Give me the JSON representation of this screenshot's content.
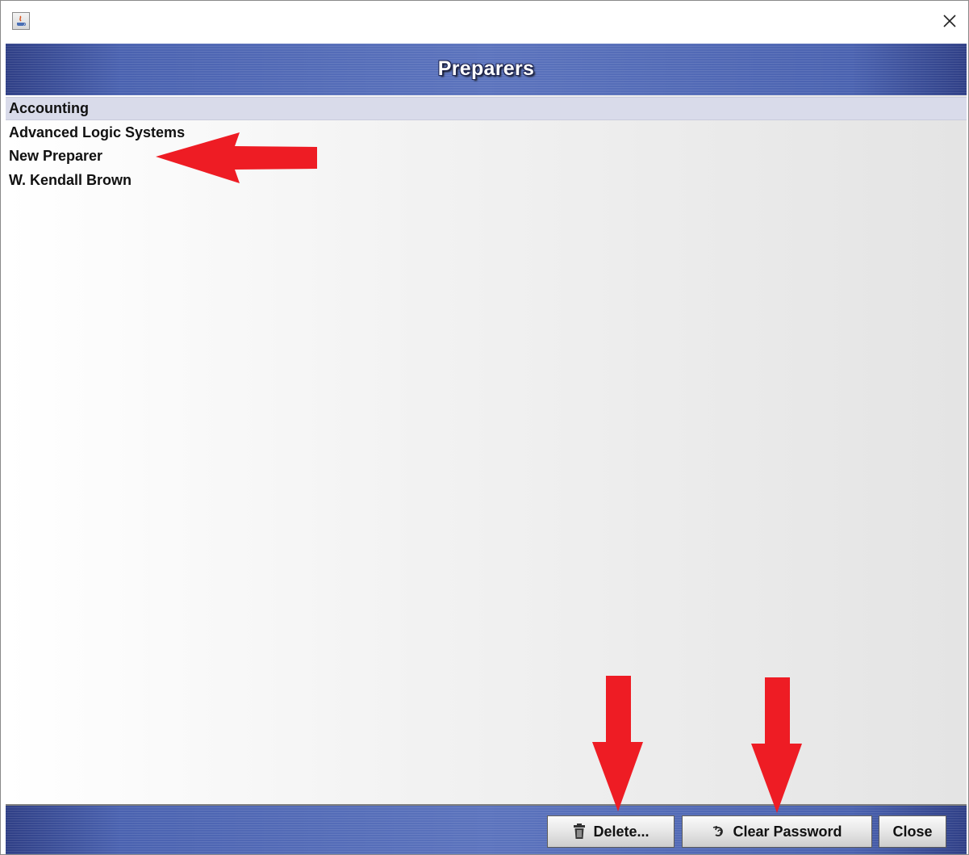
{
  "window": {
    "title_icon": "java-app-icon",
    "close_icon": "close-icon"
  },
  "header": {
    "title": "Preparers"
  },
  "list": {
    "items": [
      {
        "label": "Accounting",
        "selected": true
      },
      {
        "label": "Advanced Logic Systems",
        "selected": false
      },
      {
        "label": "New Preparer",
        "selected": false
      },
      {
        "label": "W. Kendall Brown",
        "selected": false
      }
    ]
  },
  "toolbar": {
    "delete_label": "Delete...",
    "delete_icon": "trash-icon",
    "clear_password_label": "Clear Password",
    "clear_password_icon": "reset-icon",
    "close_label": "Close"
  },
  "annotations": {
    "arrow_color": "#ee1c24",
    "arrows": [
      "arrow-to-new-preparer",
      "arrow-to-delete-button",
      "arrow-to-clear-password-button"
    ]
  },
  "colors": {
    "banner": "#4a62b0",
    "selected_row": "#d9dbea"
  }
}
